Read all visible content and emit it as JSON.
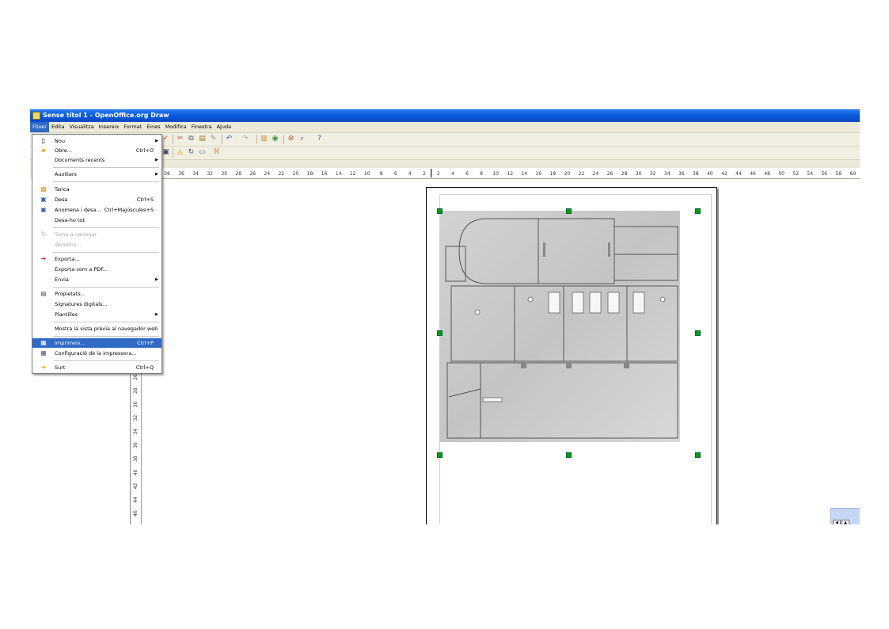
{
  "window": {
    "title": "Sense títol 1 - OpenOffice.org Draw"
  },
  "menubar": [
    "Fitxer",
    "Edita",
    "Visualitza",
    "Insereix",
    "Format",
    "Eines",
    "Modifica",
    "Finestra",
    "Ajuda"
  ],
  "active_menu": "Fitxer",
  "file_menu": {
    "items": {
      "nou": {
        "label": "Nou",
        "shortcut": ""
      },
      "obre": {
        "label": "Obre...",
        "shortcut": "Ctrl+O"
      },
      "documents_recents": {
        "label": "Documents recents",
        "shortcut": ""
      },
      "auxiliars": {
        "label": "Auxiliars",
        "shortcut": ""
      },
      "tanca": {
        "label": "Tanca",
        "shortcut": ""
      },
      "desa": {
        "label": "Desa",
        "shortcut": "Ctrl+S"
      },
      "anomena_i_desa": {
        "label": "Anomena i desa...",
        "shortcut": "Ctrl+Majúscules+S"
      },
      "desa_ho_tot": {
        "label": "Desa-ho tot",
        "shortcut": ""
      },
      "torna_a_carregar": {
        "label": "Torna a carregar",
        "shortcut": ""
      },
      "versions": {
        "label": "Versions...",
        "shortcut": ""
      },
      "exporta": {
        "label": "Exporta...",
        "shortcut": ""
      },
      "exporta_pdf": {
        "label": "Exporta com a PDF...",
        "shortcut": ""
      },
      "envia": {
        "label": "Envia",
        "shortcut": ""
      },
      "propietats": {
        "label": "Propietats...",
        "shortcut": ""
      },
      "signatures": {
        "label": "Signatures digitals...",
        "shortcut": ""
      },
      "plantilles": {
        "label": "Plantilles",
        "shortcut": ""
      },
      "vista_previa": {
        "label": "Mostra la vista prèvia al navegador web",
        "shortcut": ""
      },
      "imprimeix": {
        "label": "Imprimeix...",
        "shortcut": "Ctrl+P"
      },
      "configuracio": {
        "label": "Configuració de la impressora...",
        "shortcut": ""
      },
      "surt": {
        "label": "Surt",
        "shortcut": "Ctrl+Q"
      }
    },
    "highlighted": "Imprimeix..."
  },
  "hruler": {
    "labels": [
      "38",
      "36",
      "34",
      "32",
      "30",
      "28",
      "26",
      "24",
      "22",
      "20",
      "18",
      "16",
      "14",
      "12",
      "10",
      "8",
      "6",
      "4",
      "2",
      "2",
      "4",
      "6",
      "8",
      "10",
      "12",
      "14",
      "16",
      "18",
      "20",
      "22",
      "24",
      "26",
      "28",
      "30",
      "32",
      "34",
      "36",
      "38",
      "40",
      "42",
      "44",
      "46",
      "48",
      "50",
      "52",
      "54",
      "56",
      "58",
      "60"
    ]
  },
  "vruler": {
    "labels": [
      "26",
      "28",
      "30",
      "32",
      "34",
      "36",
      "38",
      "40",
      "42",
      "44",
      "46"
    ]
  }
}
